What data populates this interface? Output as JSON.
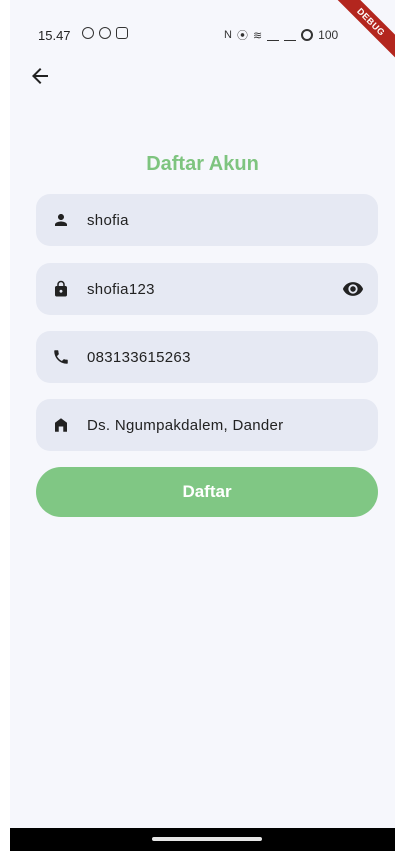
{
  "status_bar": {
    "time": "15.47",
    "left_icons": [
      "whatsapp-icon",
      "sync-icon",
      "instagram-icon"
    ],
    "right_icons": [
      "nfc-icon",
      "vibrate-icon",
      "wifi-icon",
      "signal-icon",
      "signal-icon"
    ],
    "battery": "100"
  },
  "debug_banner": "DEBUG",
  "header": {
    "back_icon": "arrow-back-icon"
  },
  "title": "Daftar Akun",
  "form": {
    "username": {
      "icon": "person-icon",
      "value": "shofia"
    },
    "password": {
      "icon": "lock-icon",
      "value": "shofia123",
      "toggle_icon": "eye-icon"
    },
    "phone": {
      "icon": "phone-icon",
      "value": "083133615263"
    },
    "address": {
      "icon": "home-icon",
      "value": "Ds. Ngumpakdalem, Dander"
    }
  },
  "submit_label": "Daftar",
  "colors": {
    "accent": "#80c784",
    "title": "#7ec47f",
    "field_bg": "#e6e9f3",
    "background": "#f6f7fc",
    "debug": "#b3261e"
  }
}
